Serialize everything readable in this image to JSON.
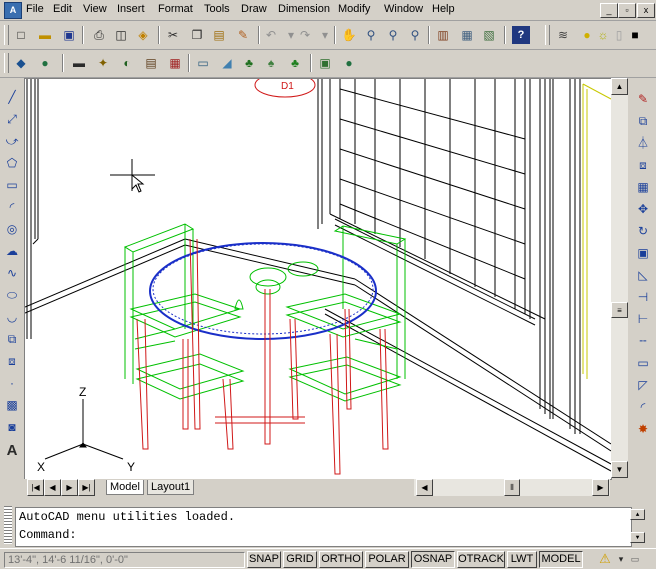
{
  "menu": {
    "items": [
      "File",
      "Edit",
      "View",
      "Insert",
      "Format",
      "Tools",
      "Draw",
      "Dimension",
      "Modify",
      "Window",
      "Help"
    ],
    "window_buttons": [
      "_",
      "▫",
      "x"
    ]
  },
  "drawing": {
    "ucs_labels": {
      "z": "Z",
      "x": "X",
      "y": "Y"
    },
    "annotation": "D1"
  },
  "tabs": {
    "nav_buttons": [
      "|◀",
      "◀",
      "▶",
      "▶|"
    ],
    "items": [
      {
        "label": "Model",
        "active": true
      },
      {
        "label": "Layout1",
        "active": false
      }
    ]
  },
  "command": {
    "history": "AutoCAD menu utilities loaded.",
    "prompt": "Command:"
  },
  "status": {
    "coordinates": "13'-4\", 14'-6 11/16\", 0'-0\"",
    "toggles": [
      {
        "label": "SNAP",
        "on": false
      },
      {
        "label": "GRID",
        "on": false
      },
      {
        "label": "ORTHO",
        "on": false
      },
      {
        "label": "POLAR",
        "on": false
      },
      {
        "label": "OSNAP",
        "on": true
      },
      {
        "label": "OTRACK",
        "on": false
      },
      {
        "label": "LWT",
        "on": false
      },
      {
        "label": "MODEL",
        "on": true
      }
    ]
  },
  "colors": {
    "table_top": "#1a2fc8",
    "chairs": "#00c000",
    "legs": "#d01818",
    "walls": "#000000",
    "trim": "#c8c800"
  }
}
